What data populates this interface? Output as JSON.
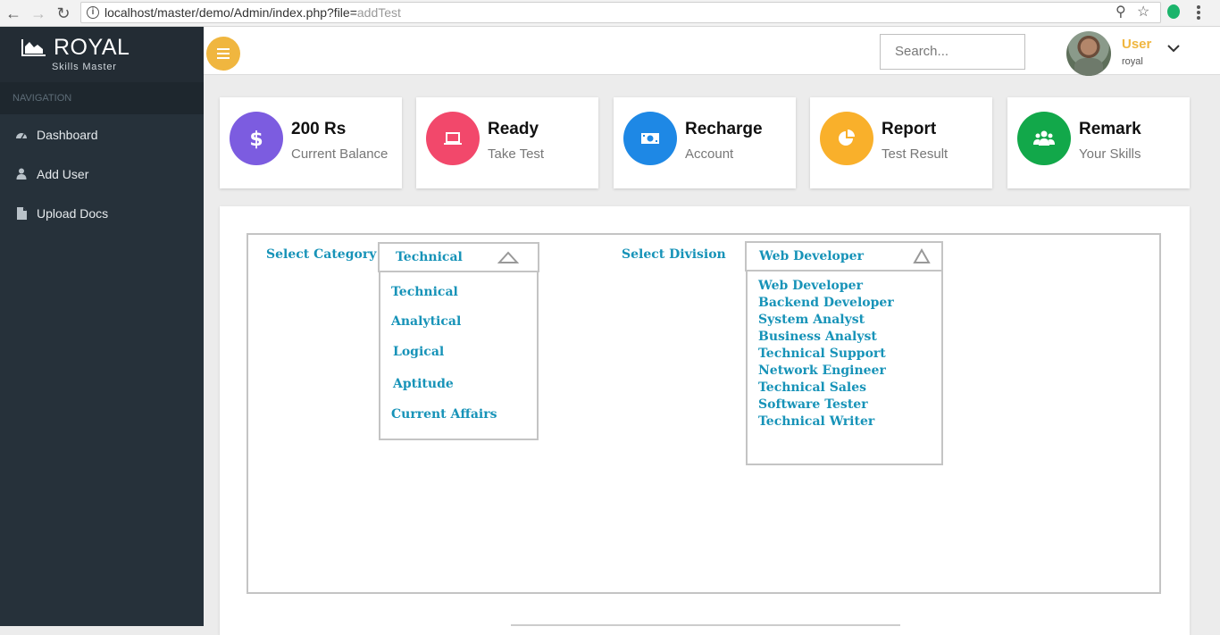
{
  "browser": {
    "url_main": "localhost/master/demo/Admin/index.php?file=",
    "url_dim": "addTest"
  },
  "sidebar": {
    "brand_name": "ROYAL",
    "brand_sub": "Skills Master",
    "heading": "NAVIGATION",
    "items": [
      {
        "label": "Dashboard",
        "icon": "dashboard-icon"
      },
      {
        "label": "Add User",
        "icon": "user-icon"
      },
      {
        "label": "Upload Docs",
        "icon": "document-icon"
      }
    ]
  },
  "topbar": {
    "search_placeholder": "Search...",
    "user_name": "User",
    "user_role": "royal"
  },
  "cards": [
    {
      "title": "200 Rs",
      "sub": "Current Balance",
      "color": "#7c5ce0",
      "icon": "dollar-icon"
    },
    {
      "title": "Ready",
      "sub": "Take Test",
      "color": "#f2486b",
      "icon": "laptop-icon"
    },
    {
      "title": "Recharge",
      "sub": "Account",
      "color": "#1e88e5",
      "icon": "money-icon"
    },
    {
      "title": "Report",
      "sub": "Test Result",
      "color": "#f9b02b",
      "icon": "pie-chart-icon"
    },
    {
      "title": "Remark",
      "sub": "Your Skills",
      "color": "#12a84a",
      "icon": "users-icon"
    }
  ],
  "form": {
    "category_label": "Select Category",
    "category_selected": "Technical",
    "category_options": [
      "Technical",
      "Analytical",
      "Logical",
      "Aptitude",
      "Current Affairs"
    ],
    "division_label": "Select Division",
    "division_selected": "Web Developer",
    "division_options": [
      "Web Developer",
      "Backend Developer",
      "System Analyst",
      "Business Analyst",
      "Technical Support",
      "Network Engineer",
      "Technical Sales",
      "Software Tester",
      "Technical Writer"
    ]
  },
  "colors": {
    "accent": "#f0b63f",
    "sidebar_bg": "#26313a",
    "link_teal": "#1793b8"
  }
}
